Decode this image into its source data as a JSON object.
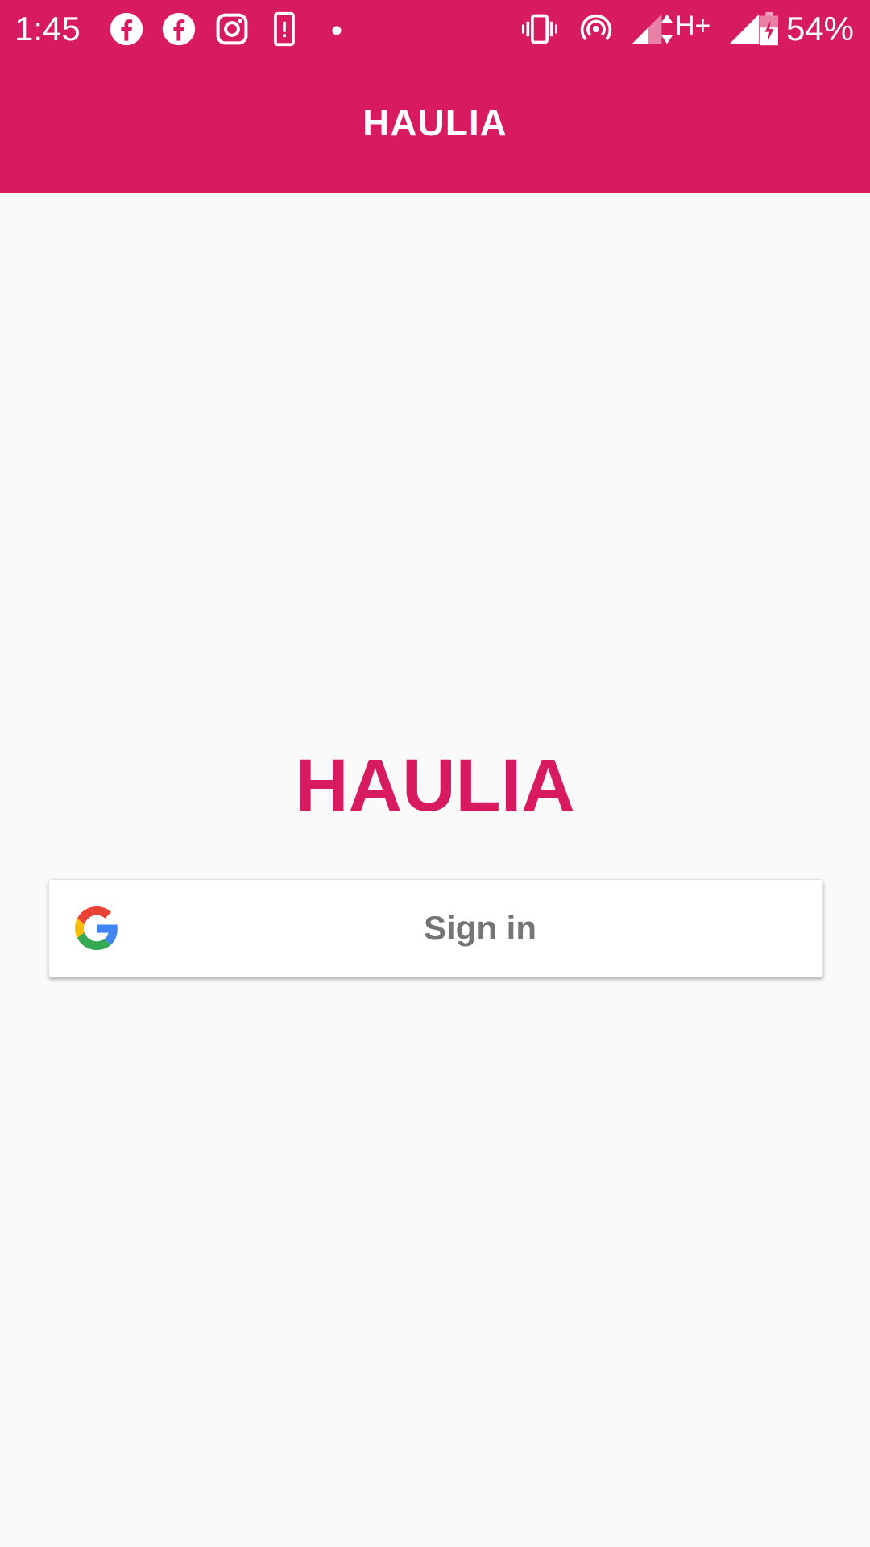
{
  "status_bar": {
    "time": "1:45",
    "battery": "54%",
    "network": "H+",
    "icons_left": [
      "facebook-icon",
      "facebook-icon",
      "instagram-icon",
      "device-alert-icon",
      "dot-icon"
    ],
    "icons_right": [
      "vibrate-icon",
      "hotspot-icon",
      "signal-icon",
      "signal-icon",
      "battery-icon"
    ]
  },
  "app_bar": {
    "title": "HAULIA"
  },
  "main": {
    "brand_title": "HAULIA",
    "signin_label": "Sign in"
  },
  "colors": {
    "primary": "#d81b60",
    "background": "#fafafa",
    "button_text": "#757575"
  }
}
